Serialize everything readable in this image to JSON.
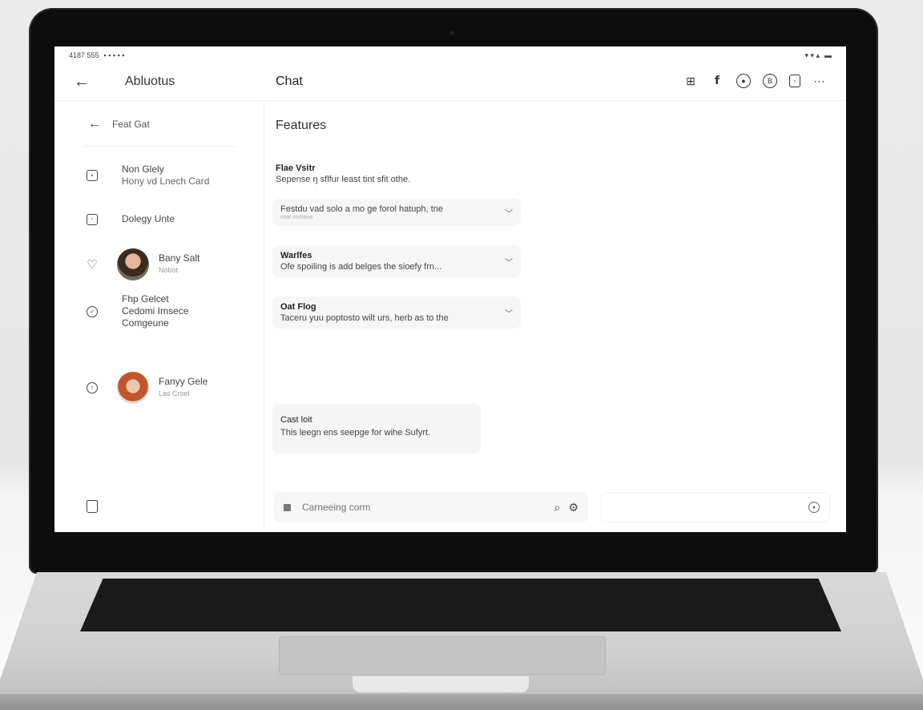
{
  "statusbar": {
    "left": "4187 555",
    "right": "▾ ▾ ▴"
  },
  "header": {
    "app_title": "Abluotus",
    "chat_title": "Chat"
  },
  "sidebar": {
    "back_label": "Feat Gat",
    "items": [
      {
        "title": "Non Glely",
        "subtitle": "Hony vd Lnech Card"
      },
      {
        "title": "Dolegy Unte"
      },
      {
        "title": "Bany Salt",
        "subtitle": "Nobot"
      },
      {
        "title": "Fhp Gelcet",
        "line2": "Cedomi Imsece",
        "line3": "Comgeune"
      },
      {
        "title": "Fanyy Gele",
        "subtitle": "Las Croel"
      }
    ]
  },
  "main": {
    "section_title": "Features",
    "feature": {
      "title": "Flae Vsitr",
      "description": "Sepense ŋ sflfur least tint sfit othe."
    },
    "cards": [
      {
        "text": "Festdu vad solo a mo ge forol hatuph, tne",
        "subtext": "chat mohane"
      },
      {
        "title": "Warlfes",
        "text": "Ofe spoiling is add belges the sioefy frn..."
      },
      {
        "title": "Oat Flog",
        "text": "Taceru yuu poptosto wilt urs, herb as to the"
      }
    ],
    "cast": {
      "title": "Cast loit",
      "text": "This leegn ens seepge for wihe Sufyrt."
    }
  },
  "composer": {
    "placeholder": "Carneeing corm"
  }
}
